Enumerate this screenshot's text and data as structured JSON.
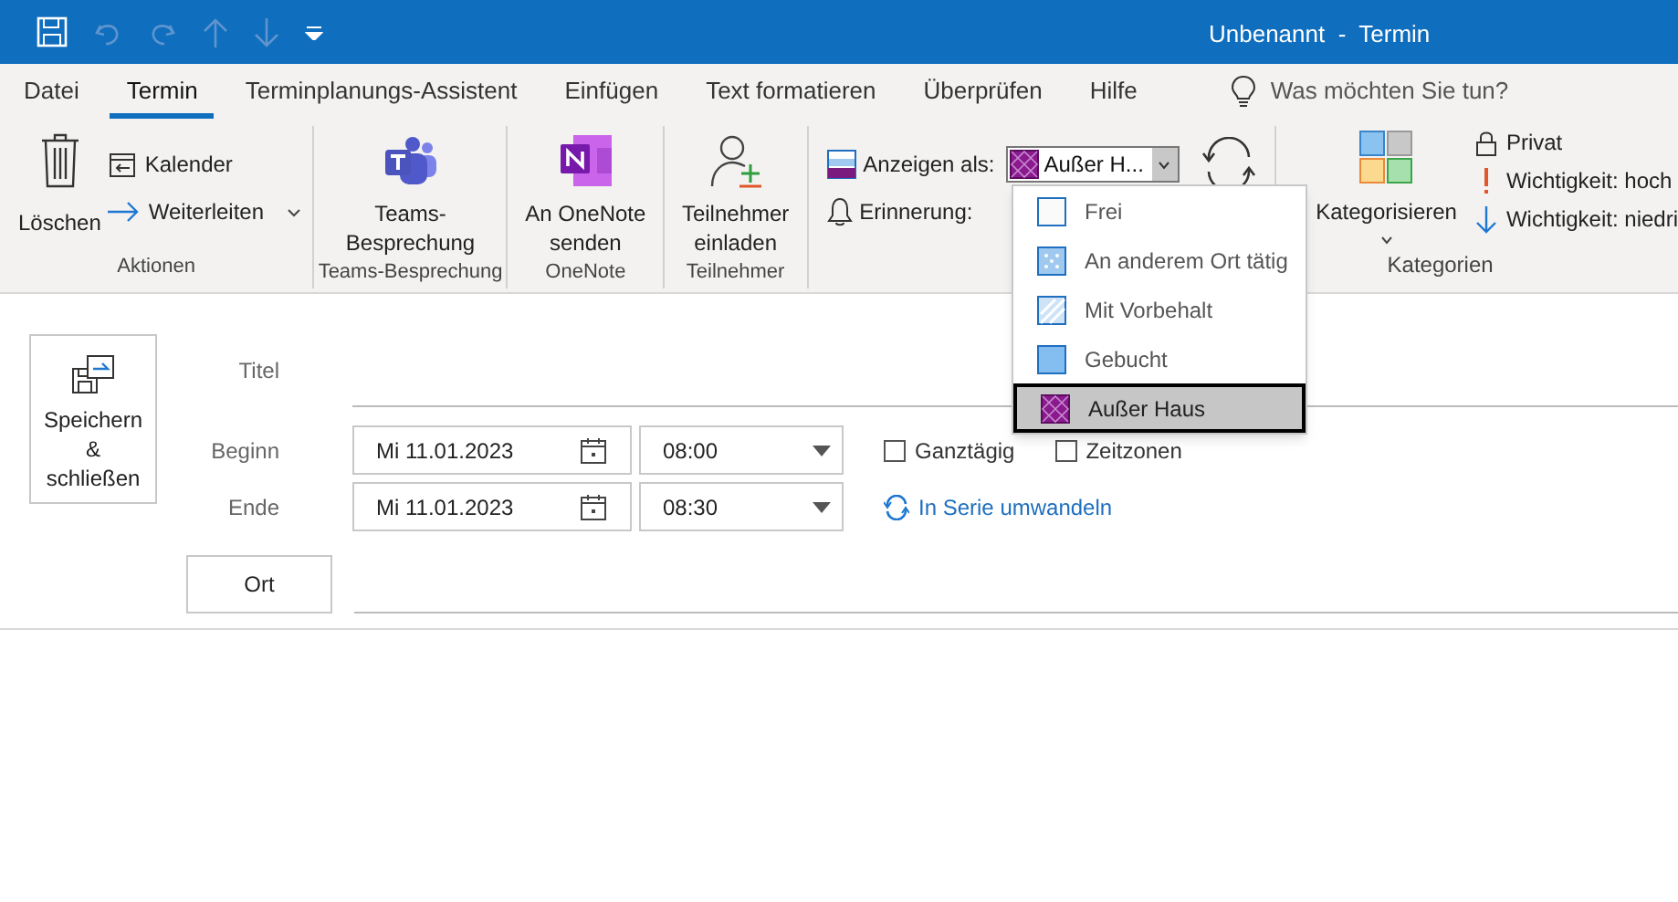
{
  "window": {
    "title": "Unbenannt  -  Termin"
  },
  "tabs": [
    {
      "label": "Datei",
      "selected": false
    },
    {
      "label": "Termin",
      "selected": true
    },
    {
      "label": "Terminplanungs-Assistent",
      "selected": false
    },
    {
      "label": "Einfügen",
      "selected": false
    },
    {
      "label": "Text formatieren",
      "selected": false
    },
    {
      "label": "Überprüfen",
      "selected": false
    },
    {
      "label": "Hilfe",
      "selected": false
    }
  ],
  "tell_me": {
    "placeholder": "Was möchten Sie tun?"
  },
  "ribbon": {
    "aktionen": {
      "label": "Aktionen",
      "delete": "Löschen",
      "calendar": "Kalender",
      "forward": "Weiterleiten"
    },
    "teams": {
      "label": "Teams-Besprechung",
      "button": "Teams-\nBesprechung"
    },
    "onenote": {
      "label": "OneNote",
      "button": "An OneNote\nsenden"
    },
    "attendees": {
      "label": "Teilnehmer",
      "button": "Teilnehmer\neinladen"
    },
    "show_as": {
      "label": "Anzeigen als:",
      "value": "Außer H...",
      "kind": "oof",
      "reminder": "Erinnerung:"
    },
    "categories": {
      "label": "Kategorien",
      "categorize": "Kategorisieren",
      "private": "Privat",
      "high": "Wichtigkeit: hoch",
      "low": "Wichtigkeit: niedri"
    }
  },
  "show_as_menu": [
    {
      "label": "Frei",
      "kind": "free",
      "selected": false
    },
    {
      "label": "An anderem Ort tätig",
      "kind": "elsewhere",
      "selected": false
    },
    {
      "label": "Mit Vorbehalt",
      "kind": "tentative",
      "selected": false
    },
    {
      "label": "Gebucht",
      "kind": "busy",
      "selected": false
    },
    {
      "label": "Außer Haus",
      "kind": "oof",
      "selected": true
    }
  ],
  "form": {
    "save": "Speichern\n&\nschließen",
    "title_label": "Titel",
    "start": {
      "label": "Beginn",
      "date": "Mi 11.01.2023",
      "time": "08:00"
    },
    "end": {
      "label": "Ende",
      "date": "Mi 11.01.2023",
      "time": "08:30"
    },
    "all_day": {
      "label": "Ganztägig",
      "checked": false
    },
    "time_zones": {
      "label": "Zeitzonen",
      "checked": false
    },
    "recurrence": "In Serie umwandeln",
    "location": "Ort"
  }
}
